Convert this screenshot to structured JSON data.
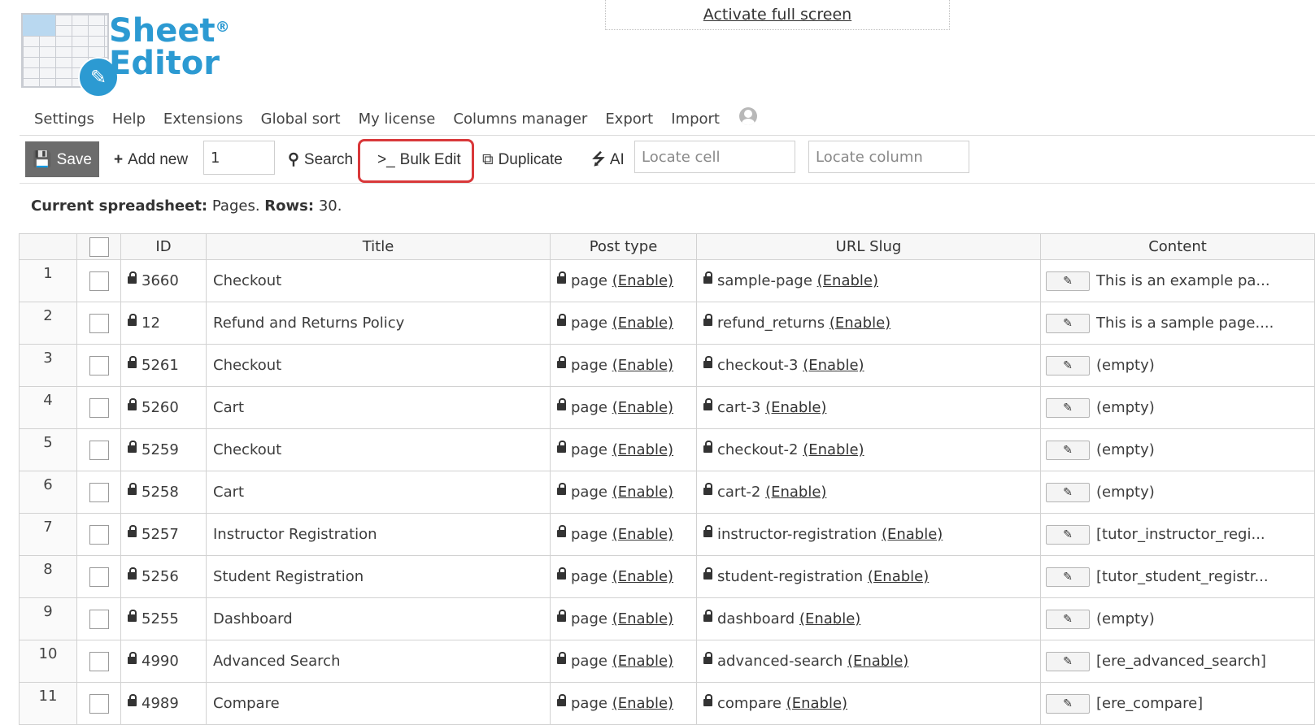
{
  "logo": {
    "line1": "Sheet",
    "line2": "Editor",
    "reg": "®",
    "badge_icon": "edit-note-icon"
  },
  "fullscreen": {
    "label": "Activate full screen"
  },
  "menu": [
    "Settings",
    "Help",
    "Extensions",
    "Global sort",
    "My license",
    "Columns manager",
    "Export",
    "Import"
  ],
  "toolbar": {
    "save": "Save",
    "add_new": "Add new",
    "add_count": "1",
    "search": "Search",
    "bulk_edit": "Bulk Edit",
    "duplicate": "Duplicate",
    "ai": "AI",
    "locate_cell": "Locate cell",
    "locate_column": "Locate column",
    "highlight_color": "#d9383a"
  },
  "status": {
    "label1": "Current spreadsheet:",
    "value1": "Pages.",
    "label2": "Rows:",
    "value2": "30."
  },
  "table": {
    "headers": [
      "ID",
      "Title",
      "Post type",
      "URL Slug",
      "Content"
    ],
    "enable_label": "(Enable)",
    "rows": [
      {
        "n": "1",
        "id": "3660",
        "title": "Checkout",
        "post_type": "page",
        "slug": "sample-page",
        "content": "This is an example pa..."
      },
      {
        "n": "2",
        "id": "12",
        "title": "Refund and Returns Policy",
        "post_type": "page",
        "slug": "refund_returns",
        "content": "This is a sample page...."
      },
      {
        "n": "3",
        "id": "5261",
        "title": "Checkout",
        "post_type": "page",
        "slug": "checkout-3",
        "content": "(empty)"
      },
      {
        "n": "4",
        "id": "5260",
        "title": "Cart",
        "post_type": "page",
        "slug": "cart-3",
        "content": "(empty)"
      },
      {
        "n": "5",
        "id": "5259",
        "title": "Checkout",
        "post_type": "page",
        "slug": "checkout-2",
        "content": "(empty)"
      },
      {
        "n": "6",
        "id": "5258",
        "title": "Cart",
        "post_type": "page",
        "slug": "cart-2",
        "content": "(empty)"
      },
      {
        "n": "7",
        "id": "5257",
        "title": "Instructor Registration",
        "post_type": "page",
        "slug": "instructor-registration",
        "content": "[tutor_instructor_regi..."
      },
      {
        "n": "8",
        "id": "5256",
        "title": "Student Registration",
        "post_type": "page",
        "slug": "student-registration",
        "content": "[tutor_student_registr..."
      },
      {
        "n": "9",
        "id": "5255",
        "title": "Dashboard",
        "post_type": "page",
        "slug": "dashboard",
        "content": "(empty)"
      },
      {
        "n": "10",
        "id": "4990",
        "title": "Advanced Search",
        "post_type": "page",
        "slug": "advanced-search",
        "content": "[ere_advanced_search]"
      },
      {
        "n": "11",
        "id": "4989",
        "title": "Compare",
        "post_type": "page",
        "slug": "compare",
        "content": "[ere_compare]"
      }
    ]
  }
}
